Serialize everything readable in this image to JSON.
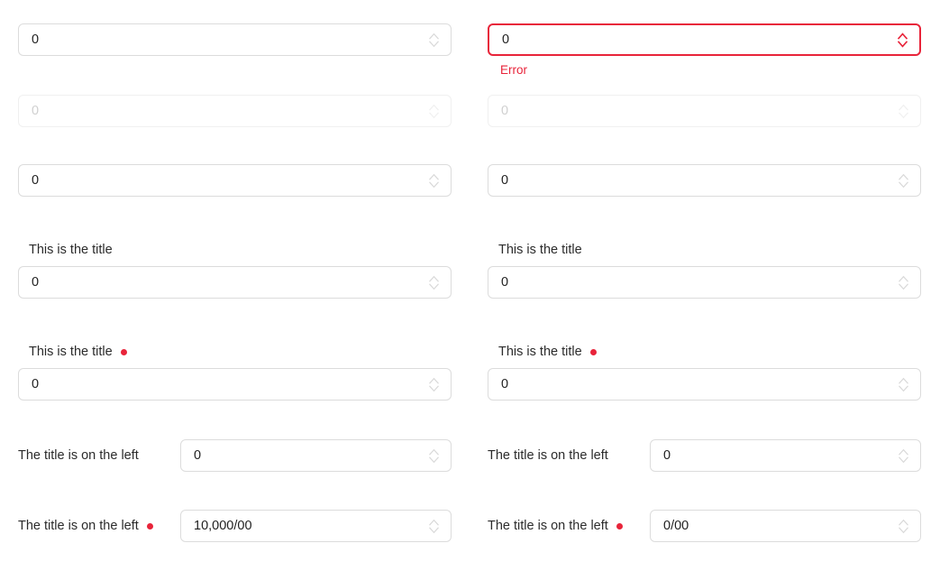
{
  "colors": {
    "error": "#e8243a",
    "border": "#dcdcdc",
    "text": "#1f1f1f",
    "disabled_text": "#d0d0d0"
  },
  "rows": [
    {
      "id": "row-default",
      "layout": "stacked",
      "left": {
        "title": "",
        "required": false,
        "value": "0",
        "state": "default",
        "error": ""
      },
      "right": {
        "title": "",
        "required": false,
        "value": "0",
        "state": "error",
        "error": "Error"
      }
    },
    {
      "id": "row-disabled",
      "layout": "stacked",
      "left": {
        "title": "",
        "required": false,
        "value": "0",
        "state": "disabled",
        "error": ""
      },
      "right": {
        "title": "",
        "required": false,
        "value": "0",
        "state": "disabled",
        "error": ""
      }
    },
    {
      "id": "row-plain",
      "layout": "stacked",
      "left": {
        "title": "",
        "required": false,
        "value": "0",
        "state": "default",
        "error": ""
      },
      "right": {
        "title": "",
        "required": false,
        "value": "0",
        "state": "default",
        "error": ""
      }
    },
    {
      "id": "row-titled",
      "layout": "stacked",
      "left": {
        "title": "This is the title",
        "required": false,
        "value": "0",
        "state": "default",
        "error": ""
      },
      "right": {
        "title": "This is the title",
        "required": false,
        "value": "0",
        "state": "default",
        "error": ""
      }
    },
    {
      "id": "row-titled-required",
      "layout": "stacked",
      "left": {
        "title": "This is the title",
        "required": true,
        "value": "0",
        "state": "default",
        "error": ""
      },
      "right": {
        "title": "This is the title",
        "required": true,
        "value": "0",
        "state": "default",
        "error": ""
      }
    },
    {
      "id": "row-inline",
      "layout": "inline",
      "left": {
        "title": "The title is on the left",
        "required": false,
        "value": "0",
        "state": "default",
        "error": ""
      },
      "right": {
        "title": "The title is on the left",
        "required": false,
        "value": "0",
        "state": "default",
        "error": ""
      }
    },
    {
      "id": "row-inline-required",
      "layout": "inline",
      "left": {
        "title": "The title is on the left",
        "required": true,
        "value": "10,000/00",
        "state": "default",
        "error": ""
      },
      "right": {
        "title": "The title is on the left",
        "required": true,
        "value": "0/00",
        "state": "default",
        "error": ""
      }
    }
  ],
  "icons": {
    "stepper": "number-stepper-icon"
  }
}
